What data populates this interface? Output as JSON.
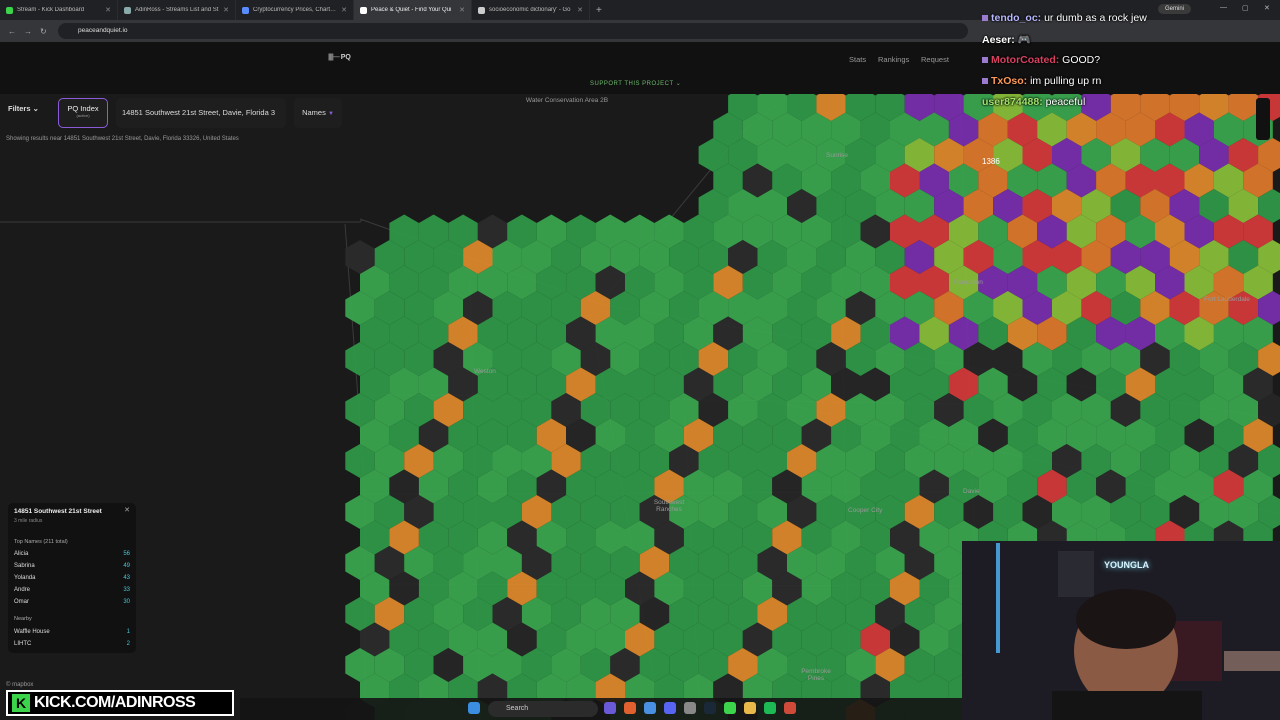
{
  "browser": {
    "tabs": [
      {
        "label": "Stream - Kick Dashboard",
        "fav": "#3bd44a"
      },
      {
        "label": "AdinRoss - Streams List and St",
        "fav": "#8aa"
      },
      {
        "label": "Cryptocurrency Prices, Charts A",
        "fav": "#5a8cff"
      },
      {
        "label": "Peace & Quiet - Find Your Qui",
        "fav": "#fff"
      },
      {
        "label": "socioeconomic dictionary' - Go",
        "fav": "#ccc"
      }
    ],
    "gemini": "Gemini",
    "url": "peaceandquiet.io"
  },
  "app": {
    "logo": "PQ",
    "nav": {
      "stats": "Stats",
      "rankings": "Rankings",
      "request": "Request"
    },
    "support": "SUPPORT THIS PROJECT ⌄"
  },
  "toolbar": {
    "filters": "Filters ⌄",
    "pq_index": "PQ Index",
    "pq_index_sub": "(active)",
    "address": "14851 Southwest 21st Street, Davie, Florida 3",
    "names": "Names"
  },
  "showing": "Showing results near 14851 Southwest 21st Street, Davie, Florida 33326, United States",
  "map_labels": {
    "water": "Water Conservation Area 2B",
    "weston": "Weston",
    "sw_ranches": "Southwest Ranches",
    "sunrise": "Sunrise",
    "plantation": "Plantation",
    "fort_lauderdale": "Fort Lauderdale",
    "davie": "Davie",
    "pembroke": "Pembroke Pines",
    "cooper": "Cooper City",
    "count": "1386"
  },
  "panel": {
    "title": "14851 Southwest 21st Street",
    "radius": "3 mile radius",
    "top_names": "Top Names (211 total)",
    "names": [
      {
        "name": "Alicia",
        "count": "56"
      },
      {
        "name": "Sabrina",
        "count": "49"
      },
      {
        "name": "Yolanda",
        "count": "43"
      },
      {
        "name": "Andre",
        "count": "33"
      },
      {
        "name": "Omar",
        "count": "30"
      }
    ],
    "nearby": "Nearby",
    "nearby_items": [
      {
        "name": "Waffle House",
        "count": "1"
      },
      {
        "name": "LIHTC",
        "count": "2"
      }
    ]
  },
  "mapbox": "© mapbox",
  "chat": [
    {
      "user": "tendo_oc:",
      "text": "ur dumb as a rock jew",
      "color": "#b7b7ff"
    },
    {
      "user": "Aeser:",
      "text": "🎮",
      "color": "#ffffff"
    },
    {
      "user": "MotorCoated:",
      "text": "GOOD?",
      "color": "#d84060"
    },
    {
      "user": "TxOso:",
      "text": "im pulling up rn",
      "color": "#ff9a5a"
    },
    {
      "user": "user874488:",
      "text": "peaceful",
      "color": "#9fe06a"
    }
  ],
  "webcam": {
    "neon": "YOUNGLA"
  },
  "kick": {
    "text": "KICK.COM/ADINROSS"
  },
  "taskbar": {
    "search": "Search"
  }
}
